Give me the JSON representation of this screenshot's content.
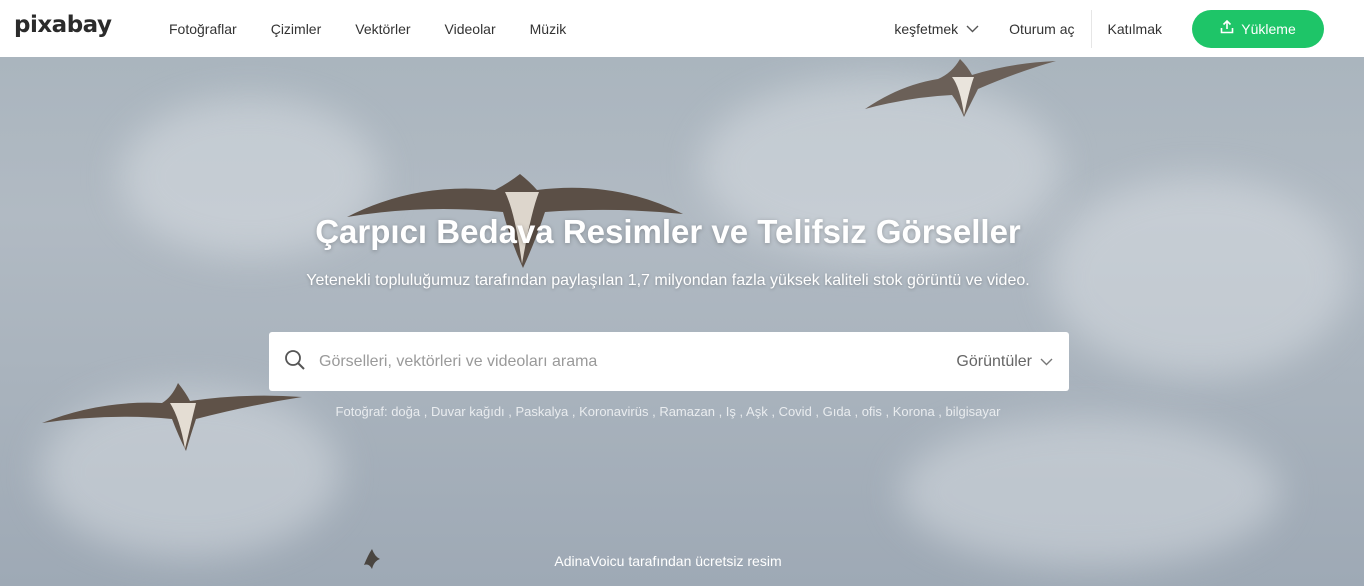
{
  "brand": {
    "logo_text": "pixabay"
  },
  "nav": {
    "items": [
      {
        "label": "Fotoğraflar"
      },
      {
        "label": "Çizimler"
      },
      {
        "label": "Vektörler"
      },
      {
        "label": "Videolar"
      },
      {
        "label": "Müzik"
      }
    ]
  },
  "right_nav": {
    "explore": "keşfetmek",
    "login": "Oturum aç",
    "join": "Katılmak",
    "upload": "Yükleme"
  },
  "hero": {
    "title": "Çarpıcı Bedava Resimler ve Telifsiz Görseller",
    "subtitle": "Yetenekli topluluğumuz tarafından paylaşılan 1,7 milyondan fazla yüksek kaliteli stok görüntü ve video."
  },
  "search": {
    "placeholder": "Görselleri, vektörleri ve videoları arama",
    "value": "",
    "type_selected": "Görüntüler"
  },
  "tags": {
    "prefix": "Fotoğraf:",
    "items": [
      "doğa",
      "Duvar kağıdı",
      "Paskalya",
      "Koronavirüs",
      "Ramazan",
      "Iş",
      "Aşk",
      "Covid",
      "Gıda",
      "ofis",
      "Korona",
      "bilgisayar"
    ]
  },
  "credit": "AdinaVoicu tarafından ücretsiz resim",
  "colors": {
    "accent": "#1ec568",
    "header_bg": "#ffffff",
    "sky": "#aab5be"
  },
  "icons": [
    "search-icon",
    "chevron-down-icon",
    "upload-icon"
  ]
}
